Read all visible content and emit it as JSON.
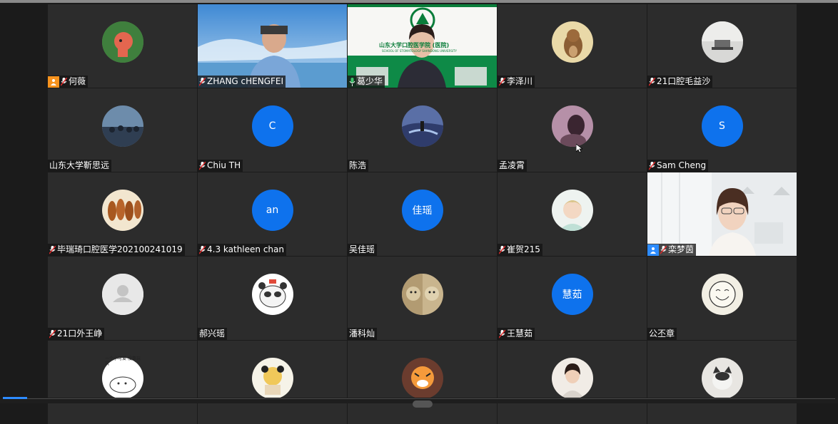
{
  "colors": {
    "accent": "#0e72ed",
    "tile_bg": "#2c2c2c",
    "host_badge_orange": "#f7931e",
    "host_badge_blue": "#2d8cff"
  },
  "participants": [
    {
      "name": "何薇",
      "avatar": "cartoon-photo",
      "host_icon": true,
      "host_color": "orange"
    },
    {
      "name": "ZHANG cHENGFEI",
      "avatar": "video"
    },
    {
      "name": "葛少华",
      "avatar": "video",
      "mic_active": true
    },
    {
      "name": "李泽川",
      "avatar": "squirrel-photo"
    },
    {
      "name": "21口腔毛益沙",
      "avatar": "tray-photo"
    },
    {
      "name": "山东大学靳思远",
      "avatar": "crowd-photo",
      "no_mic": true
    },
    {
      "name": "Chiu TH",
      "avatar": "initials",
      "initials": "C"
    },
    {
      "name": "陈浩",
      "avatar": "sea-photo",
      "no_mic": true
    },
    {
      "name": "孟凌霄",
      "avatar": "portrait-photo",
      "no_mic": true
    },
    {
      "name": "Sam Cheng",
      "avatar": "initials",
      "initials": "S"
    },
    {
      "name": "毕瑞琦口腔医学202100241019",
      "avatar": "food-photo"
    },
    {
      "name": "4.3 kathleen chan",
      "avatar": "initials",
      "initials": "an"
    },
    {
      "name": "吴佳瑶",
      "avatar": "initials",
      "initials": "佳瑶",
      "no_mic": true
    },
    {
      "name": "崔贺215",
      "avatar": "girl-photo"
    },
    {
      "name": "栾梦茵",
      "avatar": "video",
      "host_icon": true,
      "host_color": "blue"
    },
    {
      "name": "21口外王峥",
      "avatar": "default-person"
    },
    {
      "name": "郝兴瑶",
      "avatar": "panda-photo",
      "no_mic": true
    },
    {
      "name": "潘科灿",
      "avatar": "cats-photo",
      "no_mic": true
    },
    {
      "name": "王慧茹",
      "avatar": "initials",
      "initials": "慧茹"
    },
    {
      "name": "公丕章",
      "avatar": "smile-sketch",
      "no_mic": true
    },
    {
      "name": "",
      "avatar": "doodle-photo",
      "doodle_text": "一个小可爱 没事玩玩"
    },
    {
      "name": "",
      "avatar": "panda-girl-photo"
    },
    {
      "name": "",
      "avatar": "tiger-photo"
    },
    {
      "name": "",
      "avatar": "woman-photo"
    },
    {
      "name": "",
      "avatar": "cat-photo"
    }
  ],
  "video_tiles": {
    "zhang": {
      "sky_color": "#4b95d6"
    },
    "ge": {
      "banner_text": "山东大学口腔医学院 (医院)",
      "banner_sub": "SCHOOL OF STOMATOLOGY SHANDONG UNIVERSITY"
    }
  }
}
